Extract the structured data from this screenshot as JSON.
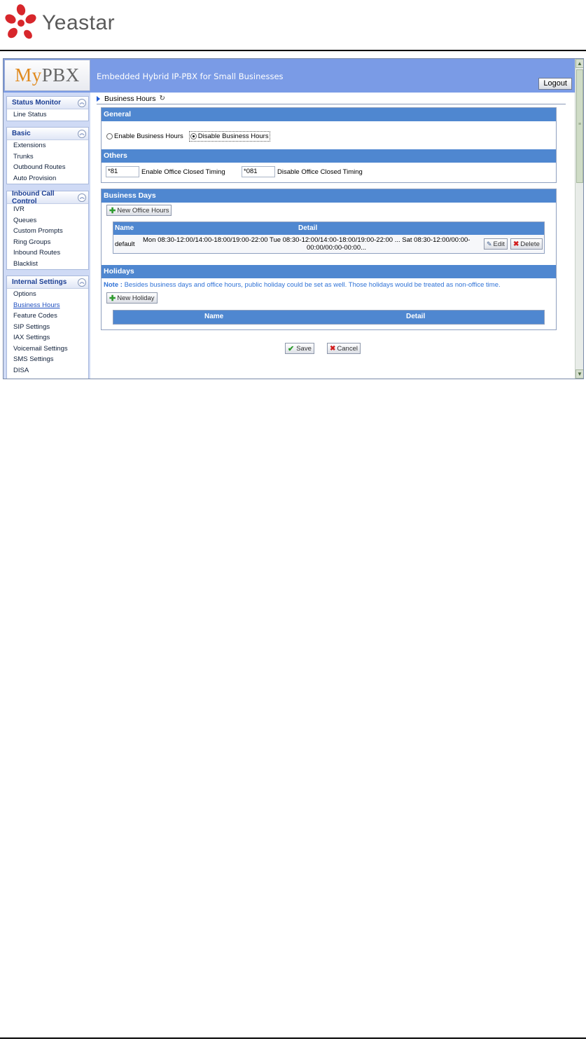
{
  "doc": {
    "logo_text": "Yeastar"
  },
  "app": {
    "brand_my": "My",
    "brand_pbx": "PBX",
    "title": "Embedded Hybrid IP-PBX for Small Businesses",
    "logout_label": "Logout"
  },
  "sidebar": {
    "groups": [
      {
        "title": "Status Monitor",
        "items": [
          "Line Status"
        ]
      },
      {
        "title": "Basic",
        "items": [
          "Extensions",
          "Trunks",
          "Outbound Routes",
          "Auto Provision"
        ]
      },
      {
        "title": "Inbound Call Control",
        "items": [
          "IVR",
          "Queues",
          "Custom Prompts",
          "Ring Groups",
          "Inbound Routes",
          "Blacklist"
        ]
      },
      {
        "title": "Internal Settings",
        "items": [
          "Options",
          "Business Hours",
          "Feature Codes",
          "SIP Settings",
          "IAX Settings",
          "Voicemail Settings",
          "SMS Settings",
          "DISA"
        ]
      }
    ],
    "active_item": "Business Hours"
  },
  "breadcrumb": {
    "label": "Business Hours"
  },
  "general": {
    "title": "General",
    "enable_label": "Enable Business Hours",
    "disable_label": "Disable Business Hours",
    "selected": "disable"
  },
  "others": {
    "title": "Others",
    "enable_code": "*81",
    "enable_label": "Enable Office Closed Timing",
    "disable_code": "*081",
    "disable_label": "Disable Office Closed Timing"
  },
  "business_days": {
    "title": "Business Days",
    "new_button": "New Office Hours",
    "columns": [
      "Name",
      "Detail"
    ],
    "rows": [
      {
        "name": "default",
        "detail_line1": "Mon 08:30-12:00/14:00-18:00/19:00-22:00  Tue 08:30-12:00/14:00-18:00/19:00-22:00 ... Sat 08:30-12:00/00:00-",
        "detail_line2": "00:00/00:00-00:00..."
      }
    ],
    "edit_label": "Edit",
    "delete_label": "Delete"
  },
  "holidays": {
    "title": "Holidays",
    "note_prefix": "Note :",
    "note_text": "Besides business days and office hours, public holiday could be set as well. Those holidays would be treated as non-office time.",
    "new_button": "New Holiday",
    "columns": [
      "Name",
      "Detail"
    ]
  },
  "actions": {
    "save_label": "Save",
    "cancel_label": "Cancel"
  },
  "colors": {
    "banner": "#7a9be6",
    "panel_header": "#4f87d0",
    "sidebar_bg": "#cfdaf5",
    "note_text": "#2f72d6",
    "brand_orange": "#e08a1e"
  }
}
